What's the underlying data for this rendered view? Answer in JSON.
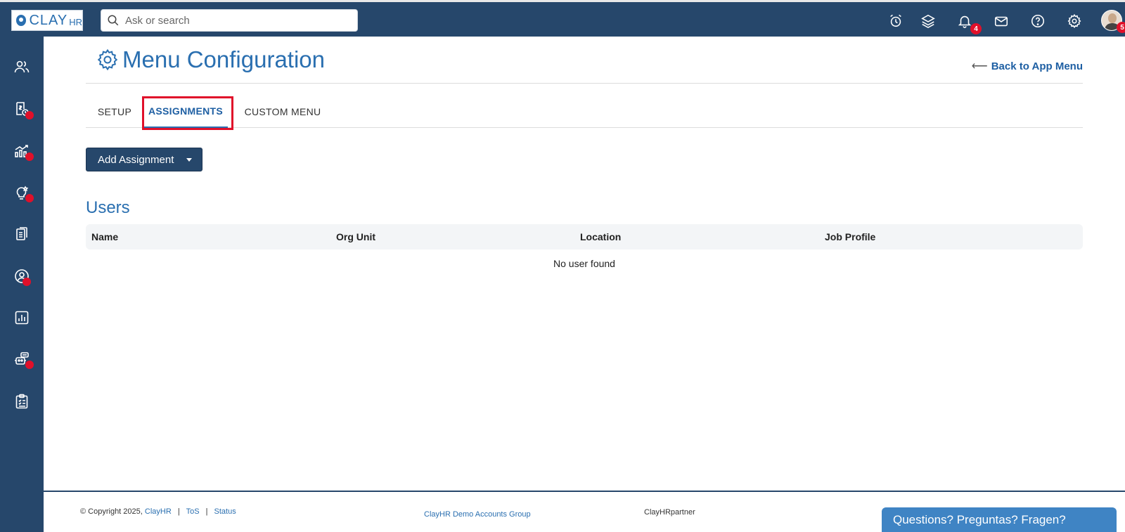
{
  "topbar": {
    "logo_main": "CLAY",
    "logo_sub": "HR",
    "search_placeholder": "Ask or search",
    "notifications_count": "4",
    "avatar_badge": "5"
  },
  "page": {
    "title": "Menu Configuration",
    "back_label": "Back to App Menu",
    "tabs": [
      {
        "label": "SETUP"
      },
      {
        "label": "ASSIGNMENTS"
      },
      {
        "label": "CUSTOM MENU"
      }
    ],
    "add_button_label": "Add Assignment",
    "section_title": "Users",
    "table": {
      "columns": [
        "Name",
        "Org Unit",
        "Location",
        "Job Profile"
      ],
      "empty_message": "No user found"
    }
  },
  "footer": {
    "copyright": "© Copyright 2025,",
    "brand_link": "ClayHR",
    "tos_link": "ToS",
    "status_link": "Status",
    "group_link": "ClayHR Demo Accounts Group",
    "partner": "ClayHRpartner"
  },
  "chat": {
    "label": "Questions? Preguntas? Fragen?"
  },
  "colors": {
    "nav_bg": "#26476b",
    "accent": "#2a6fb0",
    "alert": "#e0102a"
  }
}
